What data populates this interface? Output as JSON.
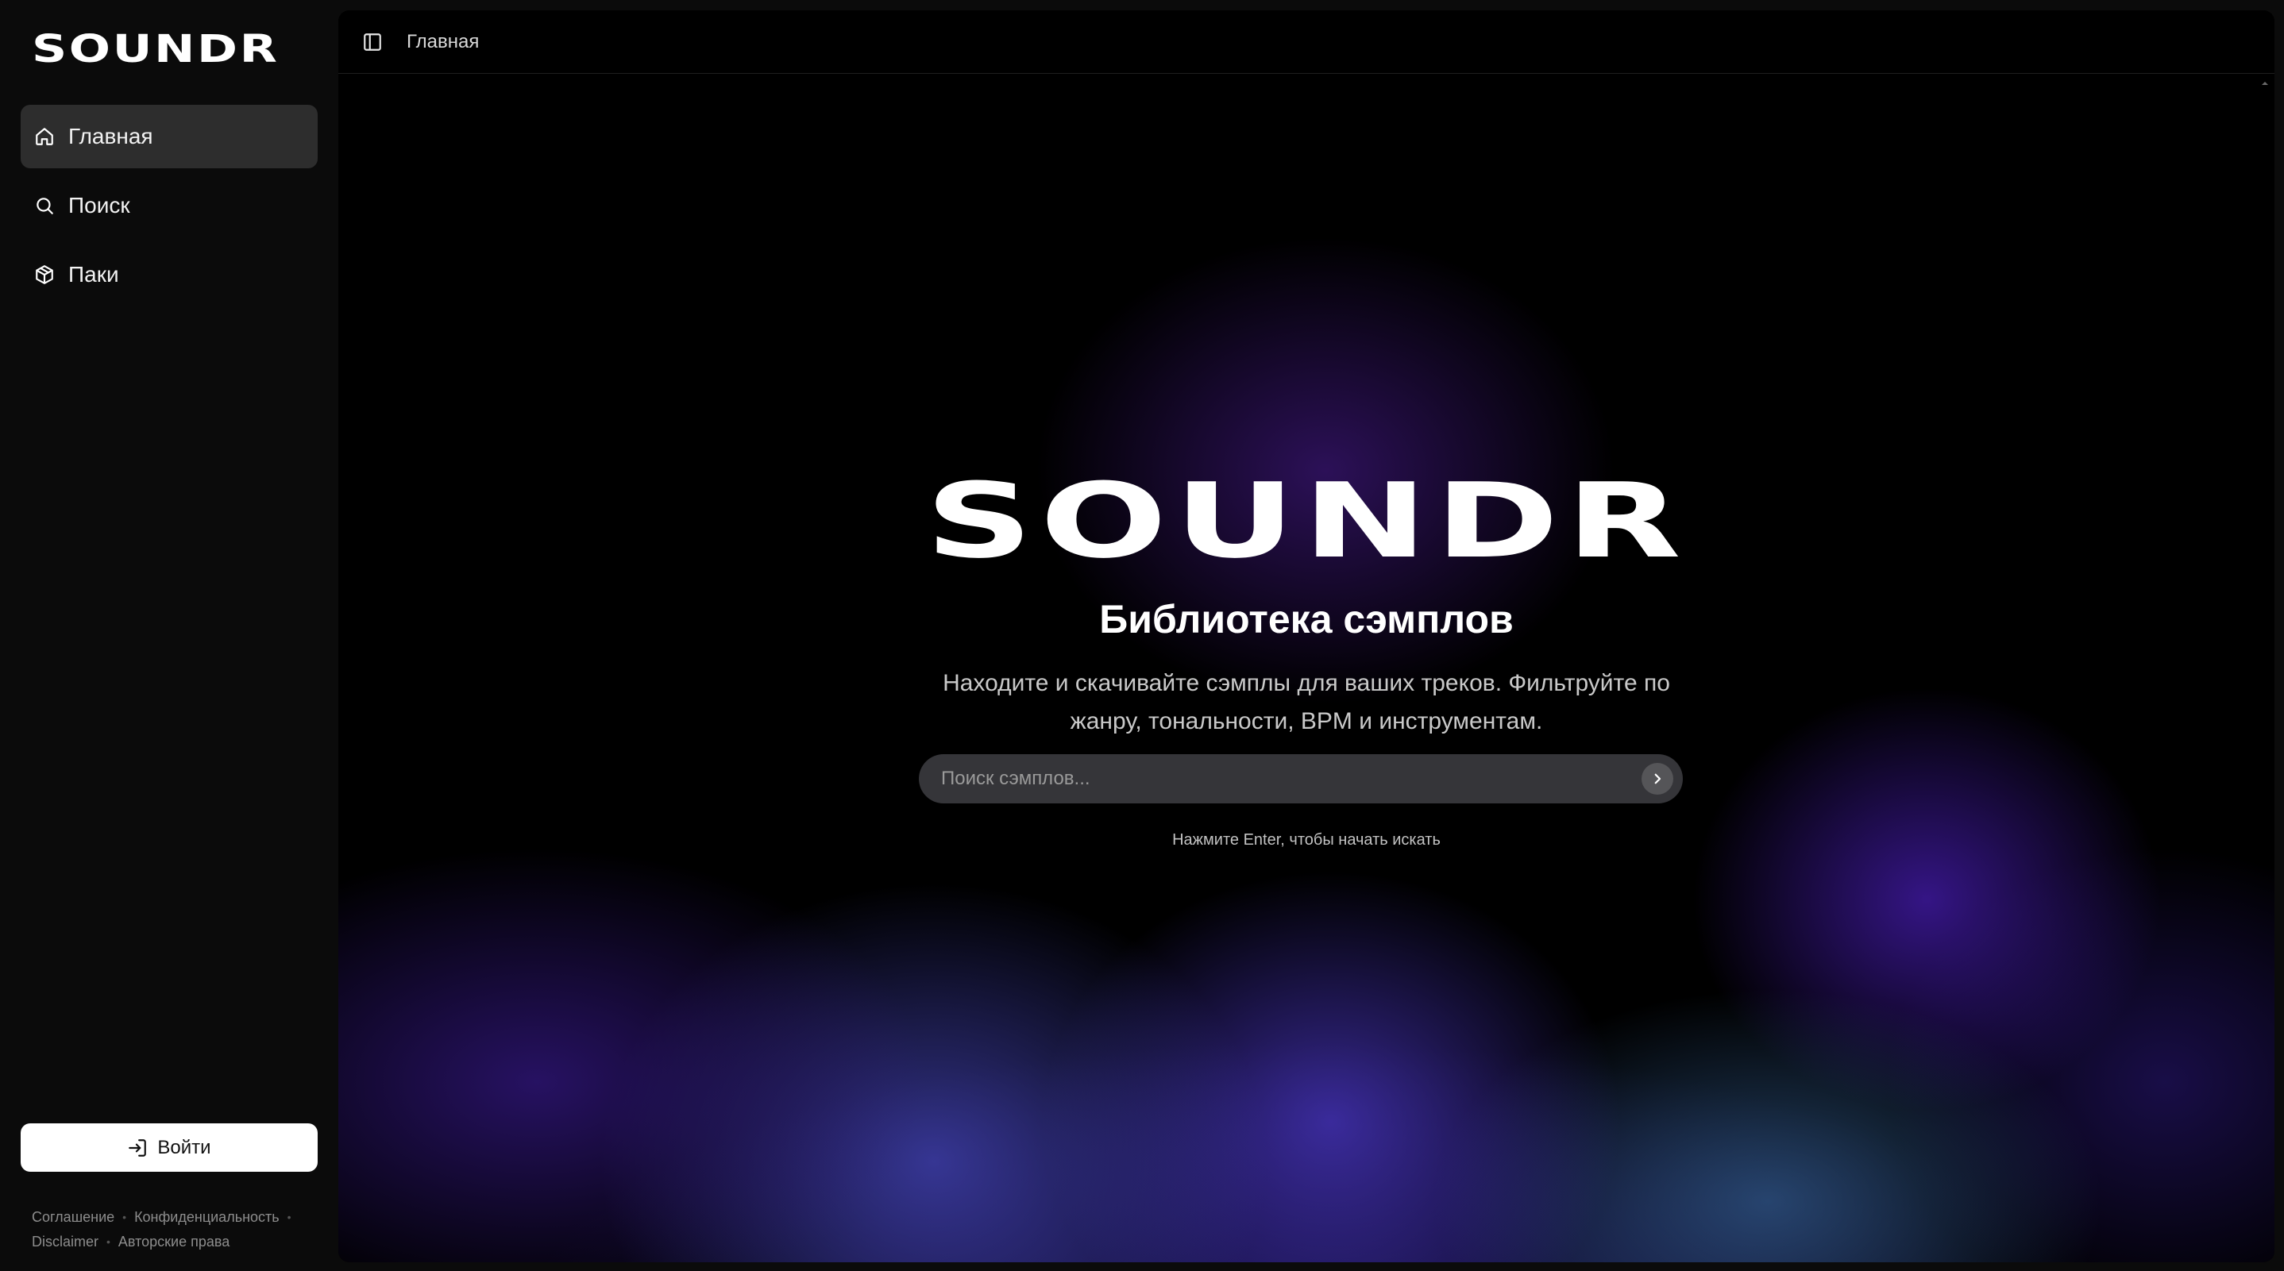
{
  "sidebar": {
    "brand": "SOUNDR",
    "items": [
      {
        "label": "Главная",
        "icon": "home-icon",
        "active": true
      },
      {
        "label": "Поиск",
        "icon": "search-icon",
        "active": false
      },
      {
        "label": "Паки",
        "icon": "package-icon",
        "active": false
      }
    ],
    "login_label": "Войти",
    "footer_links": [
      "Соглашение",
      "Конфиденциальность",
      "Disclaimer",
      "Авторские права"
    ]
  },
  "topbar": {
    "breadcrumb": "Главная"
  },
  "hero": {
    "logo": "SOUNDR",
    "title": "Библиотека сэмплов",
    "description": "Находите и скачивайте сэмплы для ваших треков. Фильтруйте по жанру, тональности, BPM и инструментам.",
    "search_placeholder": "Поиск сэмплов...",
    "search_value": "",
    "hint": "Нажмите Enter, чтобы начать искать"
  },
  "colors": {
    "background": "#0b0b0b",
    "panel": "#000000",
    "active_item": "#2d2d2d",
    "accent_purple": "#4b1ebe",
    "login_button": "#ffffff"
  }
}
